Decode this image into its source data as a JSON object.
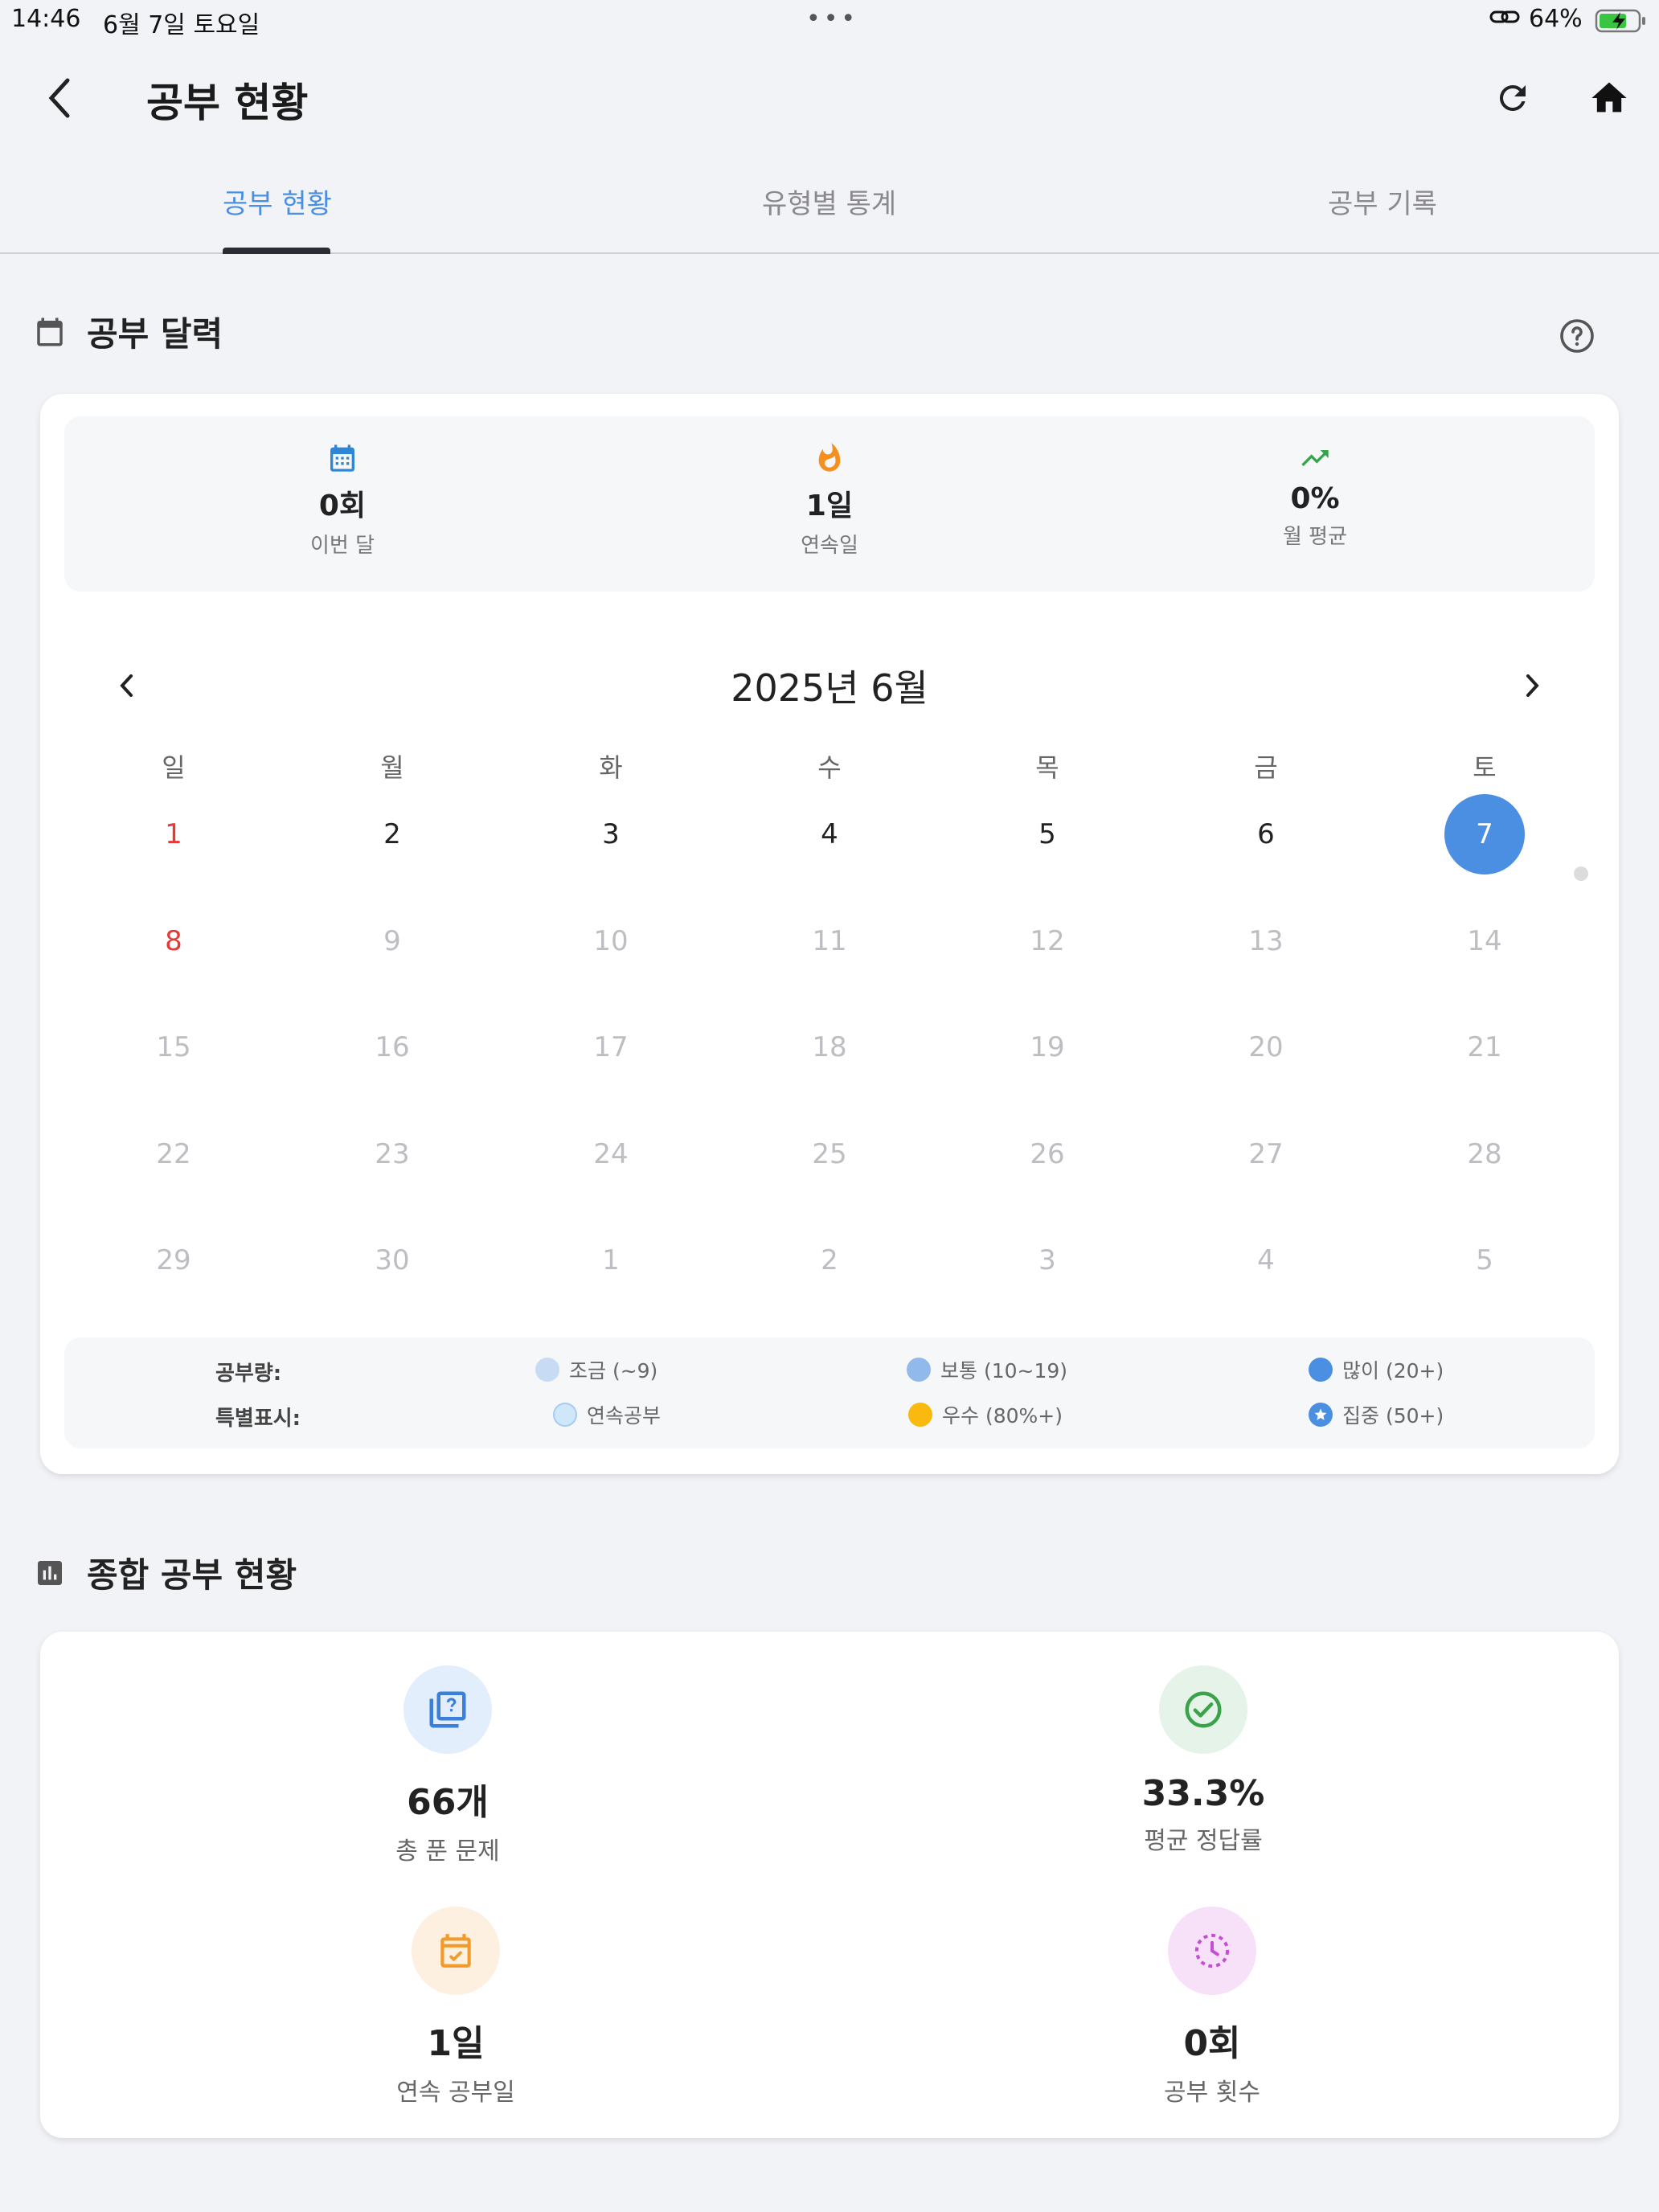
{
  "status_bar": {
    "time": "14:46",
    "date": "6월 7일 토요일",
    "battery_pct": "64%"
  },
  "app_bar": {
    "title": "공부 현황",
    "back_icon": "chevron-left-icon",
    "refresh_icon": "refresh-icon",
    "home_icon": "home-icon"
  },
  "tabs": [
    {
      "label": "공부 현황",
      "active": true
    },
    {
      "label": "유형별 통계",
      "active": false
    },
    {
      "label": "공부 기록",
      "active": false
    }
  ],
  "calendar_section": {
    "title": "공부 달력",
    "summary": [
      {
        "icon": "calendar-icon",
        "value": "0회",
        "label": "이번 달",
        "color": "#2f86d6"
      },
      {
        "icon": "fire-icon",
        "value": "1일",
        "label": "연속일",
        "color": "#f5901e"
      },
      {
        "icon": "trending-up-icon",
        "value": "0%",
        "label": "월 평균",
        "color": "#37a34a"
      }
    ],
    "month_title": "2025년 6월",
    "weekdays": [
      "일",
      "월",
      "화",
      "수",
      "목",
      "금",
      "토"
    ],
    "weeks": [
      [
        "1",
        "2",
        "3",
        "4",
        "5",
        "6",
        "7"
      ],
      [
        "8",
        "9",
        "10",
        "11",
        "12",
        "13",
        "14"
      ],
      [
        "15",
        "16",
        "17",
        "18",
        "19",
        "20",
        "21"
      ],
      [
        "22",
        "23",
        "24",
        "25",
        "26",
        "27",
        "28"
      ],
      [
        "29",
        "30",
        "1",
        "2",
        "3",
        "4",
        "5"
      ]
    ],
    "today": "7",
    "legend": {
      "amount_label": "공부량:",
      "amount": [
        {
          "label": "조금 (~9)",
          "color": "#c7dbf5"
        },
        {
          "label": "보통 (10~19)",
          "color": "#91b9ec"
        },
        {
          "label": "많이 (20+)",
          "color": "#4a8fe2"
        }
      ],
      "special_label": "특별표시:",
      "special": [
        {
          "label": "연속공부",
          "color": "#cfe6fb"
        },
        {
          "label": "우수 (80%+)",
          "color": "#f9b90f"
        },
        {
          "label": "집중 (50+)",
          "color": "#4a8fe2"
        }
      ]
    }
  },
  "overall_section": {
    "title": "종합 공부 현황",
    "stats": [
      {
        "icon": "quiz-icon",
        "value": "66개",
        "label": "총 푼 문제",
        "bg": "#e3eefc",
        "color": "#3b7fd8"
      },
      {
        "icon": "check-circle-icon",
        "value": "33.3%",
        "label": "평균 정답률",
        "bg": "#e5f3e8",
        "color": "#3aa24b"
      },
      {
        "icon": "event-available-icon",
        "value": "1일",
        "label": "연속 공부일",
        "bg": "#fdf0e0",
        "color": "#f39a2a"
      },
      {
        "icon": "clock-icon",
        "value": "0회",
        "label": "공부 횟수",
        "bg": "#f7e1f9",
        "color": "#c44fd3"
      }
    ]
  }
}
